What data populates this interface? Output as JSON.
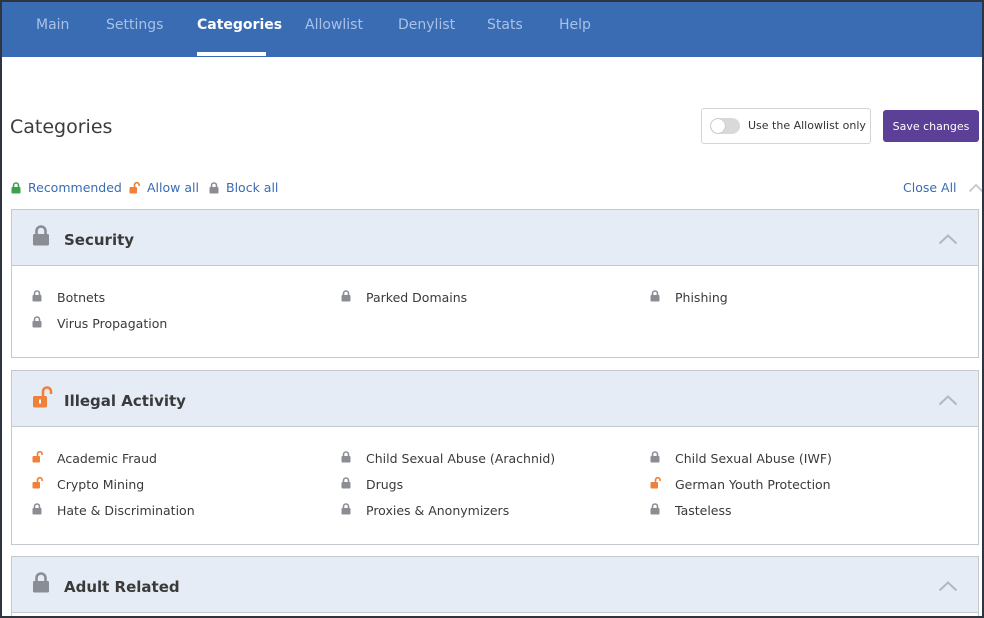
{
  "nav": {
    "items": [
      {
        "label": "Main"
      },
      {
        "label": "Settings"
      },
      {
        "label": "Categories"
      },
      {
        "label": "Allowlist"
      },
      {
        "label": "Denylist"
      },
      {
        "label": "Stats"
      },
      {
        "label": "Help"
      }
    ],
    "active": "Categories"
  },
  "page": {
    "title": "Categories",
    "toggle_label": "Use the Allowlist only",
    "toggle_on": false,
    "save_label": "Save changes"
  },
  "filters": {
    "recommended": "Recommended",
    "allow_all": "Allow all",
    "block_all": "Block all",
    "close_all": "Close All"
  },
  "colors": {
    "nav_bg": "#3a6cb4",
    "accent_purple": "#5c3f96",
    "lock_gray": "#8a8d93",
    "unlock_orange": "#f0813a",
    "recommended_green": "#3aa24a",
    "link_blue": "#3a6cb4",
    "section_header_bg": "#e6ecf6"
  },
  "sections": [
    {
      "title": "Security",
      "icon": "lock-icon",
      "items": [
        {
          "label": "Botnets",
          "icon": "lock-icon"
        },
        {
          "label": "Parked Domains",
          "icon": "lock-icon"
        },
        {
          "label": "Phishing",
          "icon": "lock-icon"
        },
        {
          "label": "Virus Propagation",
          "icon": "lock-icon"
        }
      ]
    },
    {
      "title": "Illegal Activity",
      "icon": "unlock-icon",
      "items": [
        {
          "label": "Academic Fraud",
          "icon": "unlock-icon"
        },
        {
          "label": "Child Sexual Abuse (Arachnid)",
          "icon": "lock-icon"
        },
        {
          "label": "Child Sexual Abuse (IWF)",
          "icon": "lock-icon"
        },
        {
          "label": "Crypto Mining",
          "icon": "unlock-icon"
        },
        {
          "label": "Drugs",
          "icon": "lock-icon"
        },
        {
          "label": "German Youth Protection",
          "icon": "unlock-icon"
        },
        {
          "label": "Hate & Discrimination",
          "icon": "lock-icon"
        },
        {
          "label": "Proxies & Anonymizers",
          "icon": "lock-icon"
        },
        {
          "label": "Tasteless",
          "icon": "lock-icon"
        }
      ]
    },
    {
      "title": "Adult Related",
      "icon": "lock-icon",
      "items": []
    }
  ]
}
